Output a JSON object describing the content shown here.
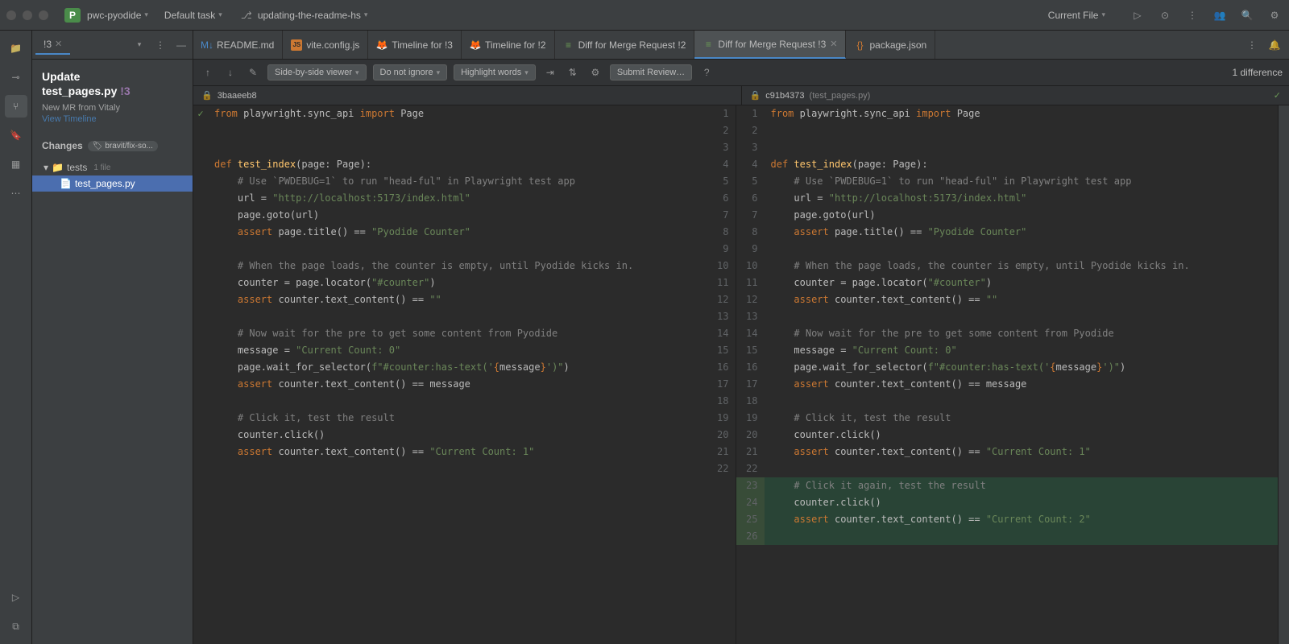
{
  "titlebar": {
    "project_badge": "P",
    "project_name": "pwc-pyodide",
    "task_label": "Default task",
    "branch_label": "updating-the-readme-hs",
    "current_file_label": "Current File"
  },
  "sidebar": {
    "tab_label": "!3",
    "title_line1": "Update",
    "title_line2": "test_pages.py",
    "title_suffix": "!3",
    "new_mr_text": "New MR from Vitaly",
    "view_timeline": "View Timeline",
    "changes_label": "Changes",
    "branch_name": "bravit/fix-so...",
    "tree": {
      "folder": "tests",
      "file_count": "1 file",
      "file": "test_pages.py"
    }
  },
  "tabs": [
    {
      "icon": "md",
      "label": "README.md"
    },
    {
      "icon": "js",
      "label": "vite.config.js"
    },
    {
      "icon": "gitlab",
      "label": "Timeline for !3"
    },
    {
      "icon": "gitlab",
      "label": "Timeline for !2"
    },
    {
      "icon": "diff",
      "label": "Diff for Merge Request !2"
    },
    {
      "icon": "diff",
      "label": "Diff for Merge Request !3",
      "active": true,
      "closeable": true
    },
    {
      "icon": "json",
      "label": "package.json"
    }
  ],
  "toolbar": {
    "viewer_mode": "Side-by-side viewer",
    "ignore_mode": "Do not ignore",
    "highlight_mode": "Highlight words",
    "submit_label": "Submit Review…",
    "diff_count": "1 difference"
  },
  "diff_header": {
    "left_hash": "3baaeeb8",
    "right_hash": "c91b4373",
    "right_filename": "(test_pages.py)"
  },
  "code_lines": [
    {
      "n": 1,
      "tokens": [
        {
          "t": "from ",
          "c": "kw"
        },
        {
          "t": "playwright.sync_api "
        },
        {
          "t": "import ",
          "c": "kw"
        },
        {
          "t": "Page"
        }
      ],
      "check": true
    },
    {
      "n": 2,
      "tokens": []
    },
    {
      "n": 3,
      "tokens": []
    },
    {
      "n": 4,
      "tokens": [
        {
          "t": "def ",
          "c": "kw"
        },
        {
          "t": "test_index",
          "c": "fn"
        },
        {
          "t": "(page: Page):"
        }
      ]
    },
    {
      "n": 5,
      "tokens": [
        {
          "t": "    "
        },
        {
          "t": "# Use `PWDEBUG=1` to run \"head-ful\" in Playwright test app",
          "c": "comment"
        }
      ]
    },
    {
      "n": 6,
      "tokens": [
        {
          "t": "    url = "
        },
        {
          "t": "\"http://localhost:5173/index.html\"",
          "c": "str"
        }
      ]
    },
    {
      "n": 7,
      "tokens": [
        {
          "t": "    page.goto(url)"
        }
      ]
    },
    {
      "n": 8,
      "tokens": [
        {
          "t": "    "
        },
        {
          "t": "assert ",
          "c": "kw"
        },
        {
          "t": "page.title() == "
        },
        {
          "t": "\"Pyodide Counter\"",
          "c": "str"
        }
      ]
    },
    {
      "n": 9,
      "tokens": []
    },
    {
      "n": 10,
      "tokens": [
        {
          "t": "    "
        },
        {
          "t": "# When the page loads, the counter is empty, until Pyodide kicks in.",
          "c": "comment"
        }
      ]
    },
    {
      "n": 11,
      "tokens": [
        {
          "t": "    counter = page.locator("
        },
        {
          "t": "\"#counter\"",
          "c": "str"
        },
        {
          "t": ")"
        }
      ]
    },
    {
      "n": 12,
      "tokens": [
        {
          "t": "    "
        },
        {
          "t": "assert ",
          "c": "kw"
        },
        {
          "t": "counter.text_content() == "
        },
        {
          "t": "\"\"",
          "c": "str"
        }
      ]
    },
    {
      "n": 13,
      "tokens": []
    },
    {
      "n": 14,
      "tokens": [
        {
          "t": "    "
        },
        {
          "t": "# Now wait for the pre to get some content from Pyodide",
          "c": "comment"
        }
      ]
    },
    {
      "n": 15,
      "tokens": [
        {
          "t": "    message = "
        },
        {
          "t": "\"Current Count: 0\"",
          "c": "str"
        }
      ]
    },
    {
      "n": 16,
      "tokens": [
        {
          "t": "    page.wait_for_selector("
        },
        {
          "t": "f\"#counter:has-text('",
          "c": "str"
        },
        {
          "t": "{",
          "c": "kw"
        },
        {
          "t": "message"
        },
        {
          "t": "}",
          "c": "kw"
        },
        {
          "t": "')\"",
          "c": "str"
        },
        {
          "t": ")"
        }
      ]
    },
    {
      "n": 17,
      "tokens": [
        {
          "t": "    "
        },
        {
          "t": "assert ",
          "c": "kw"
        },
        {
          "t": "counter.text_content() == message"
        }
      ]
    },
    {
      "n": 18,
      "tokens": []
    },
    {
      "n": 19,
      "tokens": [
        {
          "t": "    "
        },
        {
          "t": "# Click it, test the result",
          "c": "comment"
        }
      ]
    },
    {
      "n": 20,
      "tokens": [
        {
          "t": "    counter.click()"
        }
      ]
    },
    {
      "n": 21,
      "tokens": [
        {
          "t": "    "
        },
        {
          "t": "assert ",
          "c": "kw"
        },
        {
          "t": "counter.text_content() == "
        },
        {
          "t": "\"Current Count: 1\"",
          "c": "str"
        }
      ]
    },
    {
      "n": 22,
      "tokens": []
    }
  ],
  "added_lines": [
    {
      "n": 23,
      "tokens": [
        {
          "t": "    "
        },
        {
          "t": "# Click it again, test the result",
          "c": "comment"
        }
      ]
    },
    {
      "n": 24,
      "tokens": [
        {
          "t": "    counter.click()"
        }
      ]
    },
    {
      "n": 25,
      "tokens": [
        {
          "t": "    "
        },
        {
          "t": "assert ",
          "c": "kw"
        },
        {
          "t": "counter.text_content() == "
        },
        {
          "t": "\"Current Count: 2\"",
          "c": "str"
        }
      ]
    },
    {
      "n": 26,
      "tokens": []
    }
  ]
}
